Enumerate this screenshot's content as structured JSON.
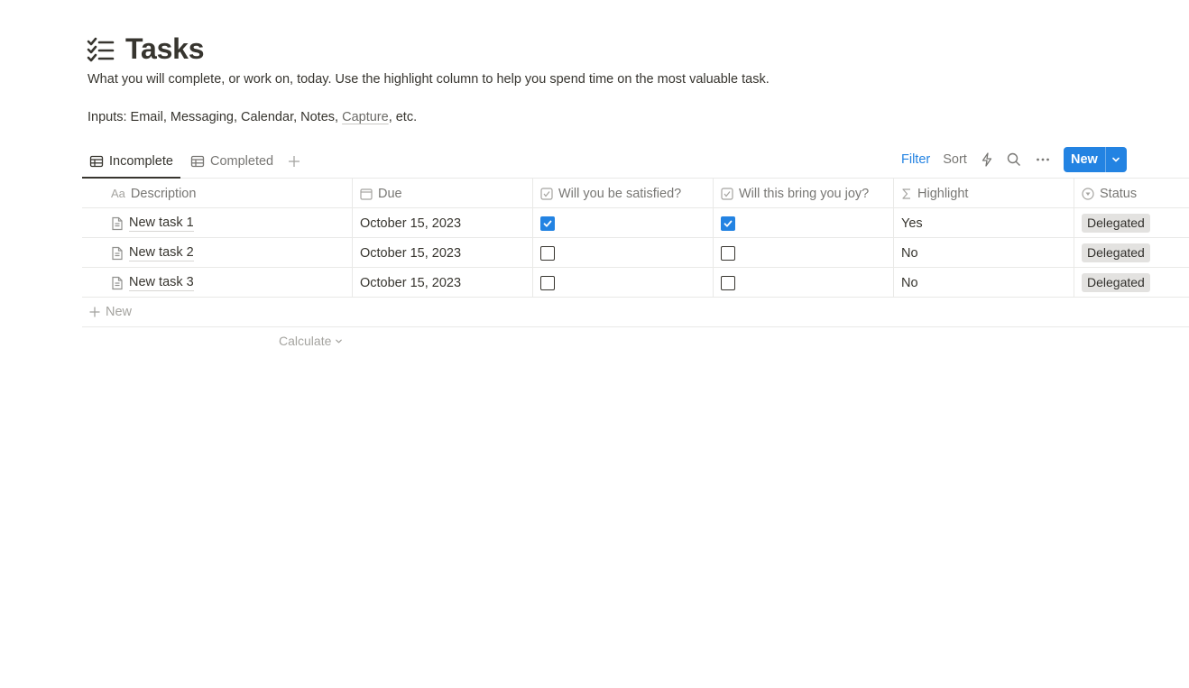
{
  "page": {
    "title": "Tasks",
    "description": "What you will complete, or work on, today. Use the highlight column to help you spend time on the most valuable task.",
    "inputs_prefix": "Inputs: Email, Messaging, Calendar, Notes, ",
    "inputs_link": "Capture",
    "inputs_suffix": ", etc."
  },
  "tabs": [
    {
      "label": "Incomplete",
      "active": true
    },
    {
      "label": "Completed",
      "active": false
    }
  ],
  "toolbar": {
    "filter_label": "Filter",
    "sort_label": "Sort",
    "new_label": "New"
  },
  "columns": [
    {
      "label": "Description",
      "icon": "text-type-icon"
    },
    {
      "label": "Due",
      "icon": "calendar-icon"
    },
    {
      "label": "Will you be satisfied?",
      "icon": "checkbox-icon"
    },
    {
      "label": "Will this bring you joy?",
      "icon": "checkbox-icon"
    },
    {
      "label": "Highlight",
      "icon": "sigma-icon"
    },
    {
      "label": "Status",
      "icon": "status-icon"
    }
  ],
  "rows": [
    {
      "name": "New task 1",
      "due": "October 15, 2023",
      "satisfied": true,
      "joy": true,
      "highlight": "Yes",
      "status": "Delegated"
    },
    {
      "name": "New task 2",
      "due": "October 15, 2023",
      "satisfied": false,
      "joy": false,
      "highlight": "No",
      "status": "Delegated"
    },
    {
      "name": "New task 3",
      "due": "October 15, 2023",
      "satisfied": false,
      "joy": false,
      "highlight": "No",
      "status": "Delegated"
    }
  ],
  "table_footer": {
    "new_row_label": "New",
    "calculate_label": "Calculate"
  },
  "colors": {
    "accent": "#2383e2",
    "text": "#37352f",
    "muted": "#787774",
    "status_tag_bg": "#e3e2e0"
  }
}
